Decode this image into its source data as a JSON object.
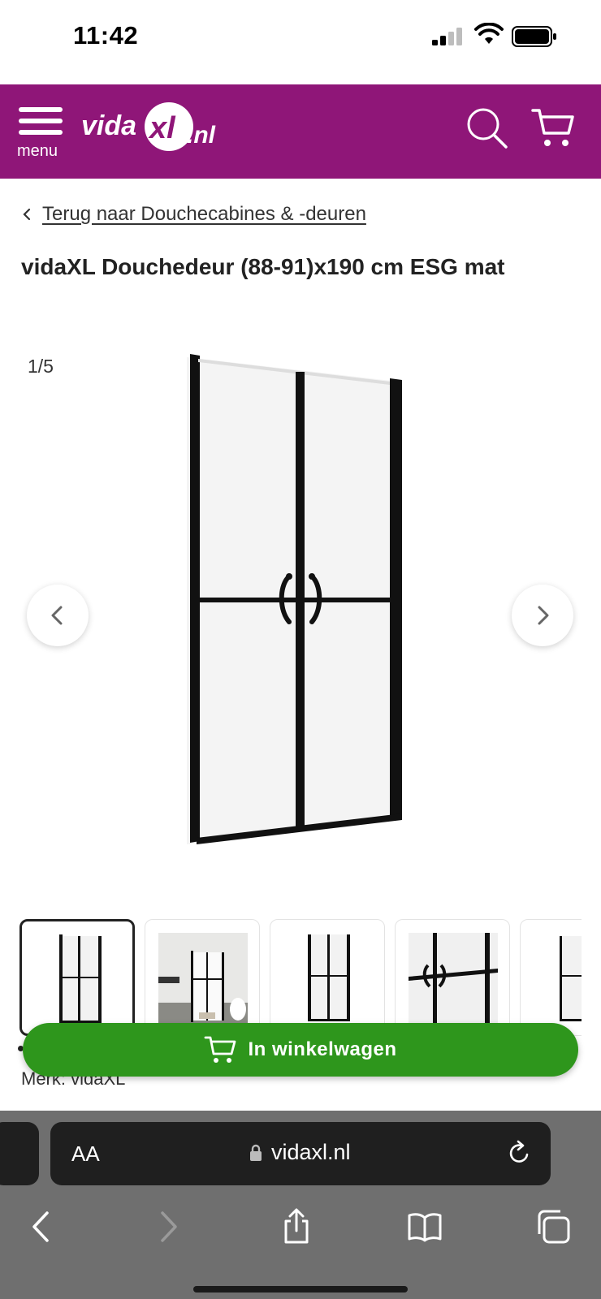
{
  "status_bar": {
    "time": "11:42"
  },
  "header": {
    "menu_label": "menu",
    "logo_text": "vidaXL.nl",
    "brand_color": "#8f1678"
  },
  "breadcrumb": {
    "back_label": "Terug naar Douchecabines & -deuren"
  },
  "product": {
    "title": "vidaXL Douchedeur (88-91)x190 cm ESG mat",
    "brand_line": "Merk: vidaXL"
  },
  "gallery": {
    "counter": "1/5",
    "thumbnails": [
      {
        "name": "shower-door-front",
        "active": true
      },
      {
        "name": "shower-door-bathroom",
        "active": false
      },
      {
        "name": "shower-door-front-alt",
        "active": false
      },
      {
        "name": "shower-door-handle-detail",
        "active": false
      },
      {
        "name": "shower-door-partial",
        "active": false
      }
    ]
  },
  "cta": {
    "add_to_cart_label": "In winkelwagen",
    "color": "#2e961c"
  },
  "browser": {
    "text_size_label": "AA",
    "domain": "vidaxl.nl"
  }
}
